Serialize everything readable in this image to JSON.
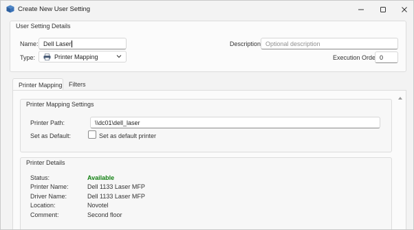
{
  "window": {
    "title": "Create New User Setting",
    "icon": "cube-icon"
  },
  "details": {
    "title": "User Setting Details",
    "name_label": "Name:",
    "name_value": "Dell Laser",
    "type_label": "Type:",
    "type_value": "Printer Mapping",
    "type_icon": "printer-icon",
    "description_label": "Description:",
    "description_value": "",
    "description_placeholder": "Optional description",
    "execution_order_label": "Execution Order:",
    "execution_order_value": "0"
  },
  "tabs": [
    {
      "label": "Printer Mapping",
      "active": true
    },
    {
      "label": "Filters",
      "active": false
    }
  ],
  "mapping_settings": {
    "title": "Printer Mapping Settings",
    "path_label": "Printer Path:",
    "path_value": "\\\\dc01\\dell_laser",
    "default_label": "Set as Default:",
    "default_checkbox_label": "Set as default printer",
    "default_checked": false
  },
  "printer_details": {
    "title": "Printer Details",
    "rows": [
      {
        "label": "Status:",
        "value": "Available"
      },
      {
        "label": "Printer Name:",
        "value": "Dell 1133 Laser MFP"
      },
      {
        "label": "Driver Name:",
        "value": "Dell 1133 Laser MFP"
      },
      {
        "label": "Location:",
        "value": "Novotel"
      },
      {
        "label": "Comment:",
        "value": "Second floor"
      }
    ]
  },
  "colors": {
    "status_available": "#118011",
    "accent": "#005fb8"
  }
}
